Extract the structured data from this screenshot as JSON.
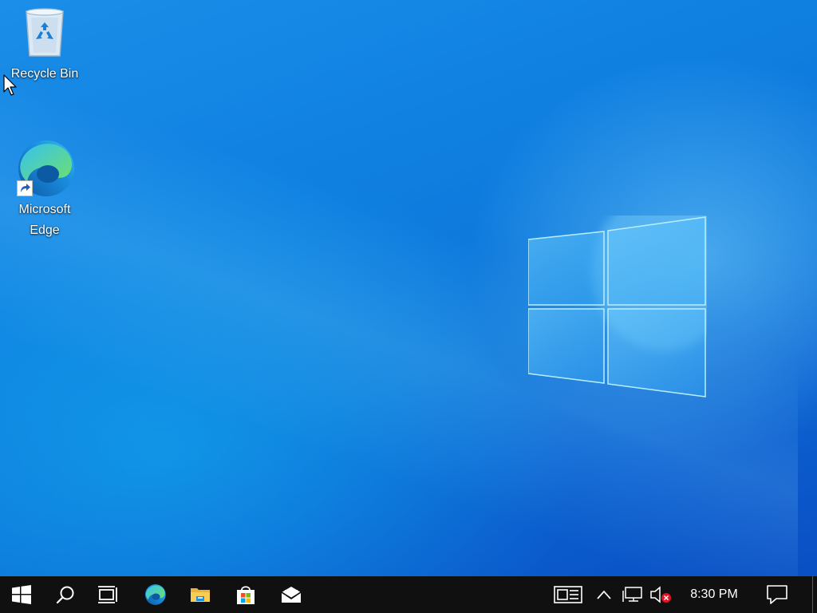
{
  "desktop": {
    "icons": [
      {
        "label": "Recycle Bin",
        "icon": "recycle-bin-icon"
      },
      {
        "label": "Microsoft Edge",
        "icon": "edge-icon",
        "shortcut": true
      }
    ]
  },
  "taskbar": {
    "start": "windows-start-icon",
    "pinned": [
      "search-icon",
      "task-view-icon",
      "edge-icon",
      "file-explorer-icon",
      "microsoft-store-icon",
      "mail-icon"
    ],
    "tray": [
      "news-and-interests-icon",
      "chevron-up-icon",
      "network-icon",
      "volume-muted-icon"
    ],
    "clock": "8:30 PM",
    "notifications": "action-center-icon"
  },
  "colors": {
    "taskbar_bg": "#101010",
    "wallpaper_accent": "#0c74d8"
  }
}
